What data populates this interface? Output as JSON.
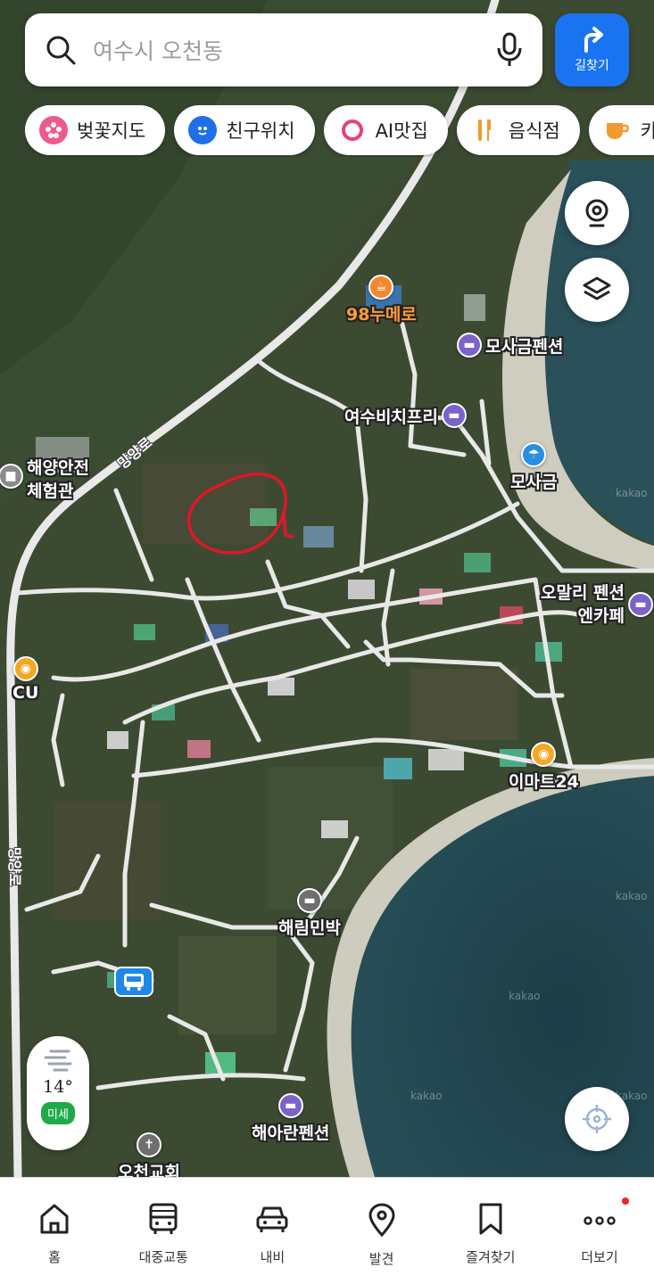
{
  "search": {
    "placeholder": "여수시 오천동",
    "directions_label": "길찾기"
  },
  "chips": [
    {
      "label": "벚꽃지도",
      "icon": "cherry-blossom-icon",
      "color": "#ef5a8c"
    },
    {
      "label": "친구위치",
      "icon": "friend-location-icon",
      "color": "#1f6fe6"
    },
    {
      "label": "AI맛집",
      "icon": "ai-ring-icon",
      "color": "#e8417e"
    },
    {
      "label": "음식점",
      "icon": "restaurant-icon",
      "color": "#f29a2e"
    },
    {
      "label": "카페",
      "icon": "cafe-icon",
      "color": "#f29a2e"
    }
  ],
  "map": {
    "road_labels": [
      "망양로",
      "망양로"
    ],
    "watermark": "kakao",
    "pois": [
      {
        "name": "98누메로",
        "icon": "cafe-icon",
        "color": "#f0892e",
        "label_color": "orange"
      },
      {
        "name": "모사금펜션",
        "icon": "lodging-icon",
        "color": "#7b63c9"
      },
      {
        "name": "여수비치프리",
        "icon": "lodging-icon",
        "color": "#7b63c9"
      },
      {
        "name": "해양안전 체험관",
        "icon": "building-icon",
        "color": "#8a8a8a"
      },
      {
        "name": "모사금",
        "icon": "beach-icon",
        "color": "#2a8fe0"
      },
      {
        "name": "오말리 펜션엔카페",
        "icon": "lodging-icon",
        "color": "#7b63c9"
      },
      {
        "name": "CU",
        "icon": "convenience-store-icon",
        "color": "#f2a825"
      },
      {
        "name": "이마트24",
        "icon": "convenience-store-icon",
        "color": "#f2a825"
      },
      {
        "name": "해림민박",
        "icon": "lodging-icon",
        "color": "#6f6f6f"
      },
      {
        "name": "해아란펜션",
        "icon": "lodging-icon",
        "color": "#7b63c9"
      },
      {
        "name": "오천교회",
        "icon": "church-icon",
        "color": "#6f6f6f"
      }
    ]
  },
  "weather": {
    "temperature": "14°",
    "dust_label": "미세",
    "dust_color": "#1faa4a"
  },
  "bottom_nav": [
    {
      "label": "홈",
      "icon": "home-icon"
    },
    {
      "label": "대중교통",
      "icon": "bus-icon"
    },
    {
      "label": "내비",
      "icon": "car-icon"
    },
    {
      "label": "발견",
      "icon": "location-pin-icon"
    },
    {
      "label": "즐겨찾기",
      "icon": "bookmark-icon"
    },
    {
      "label": "더보기",
      "icon": "more-icon",
      "has_notification": true
    }
  ]
}
